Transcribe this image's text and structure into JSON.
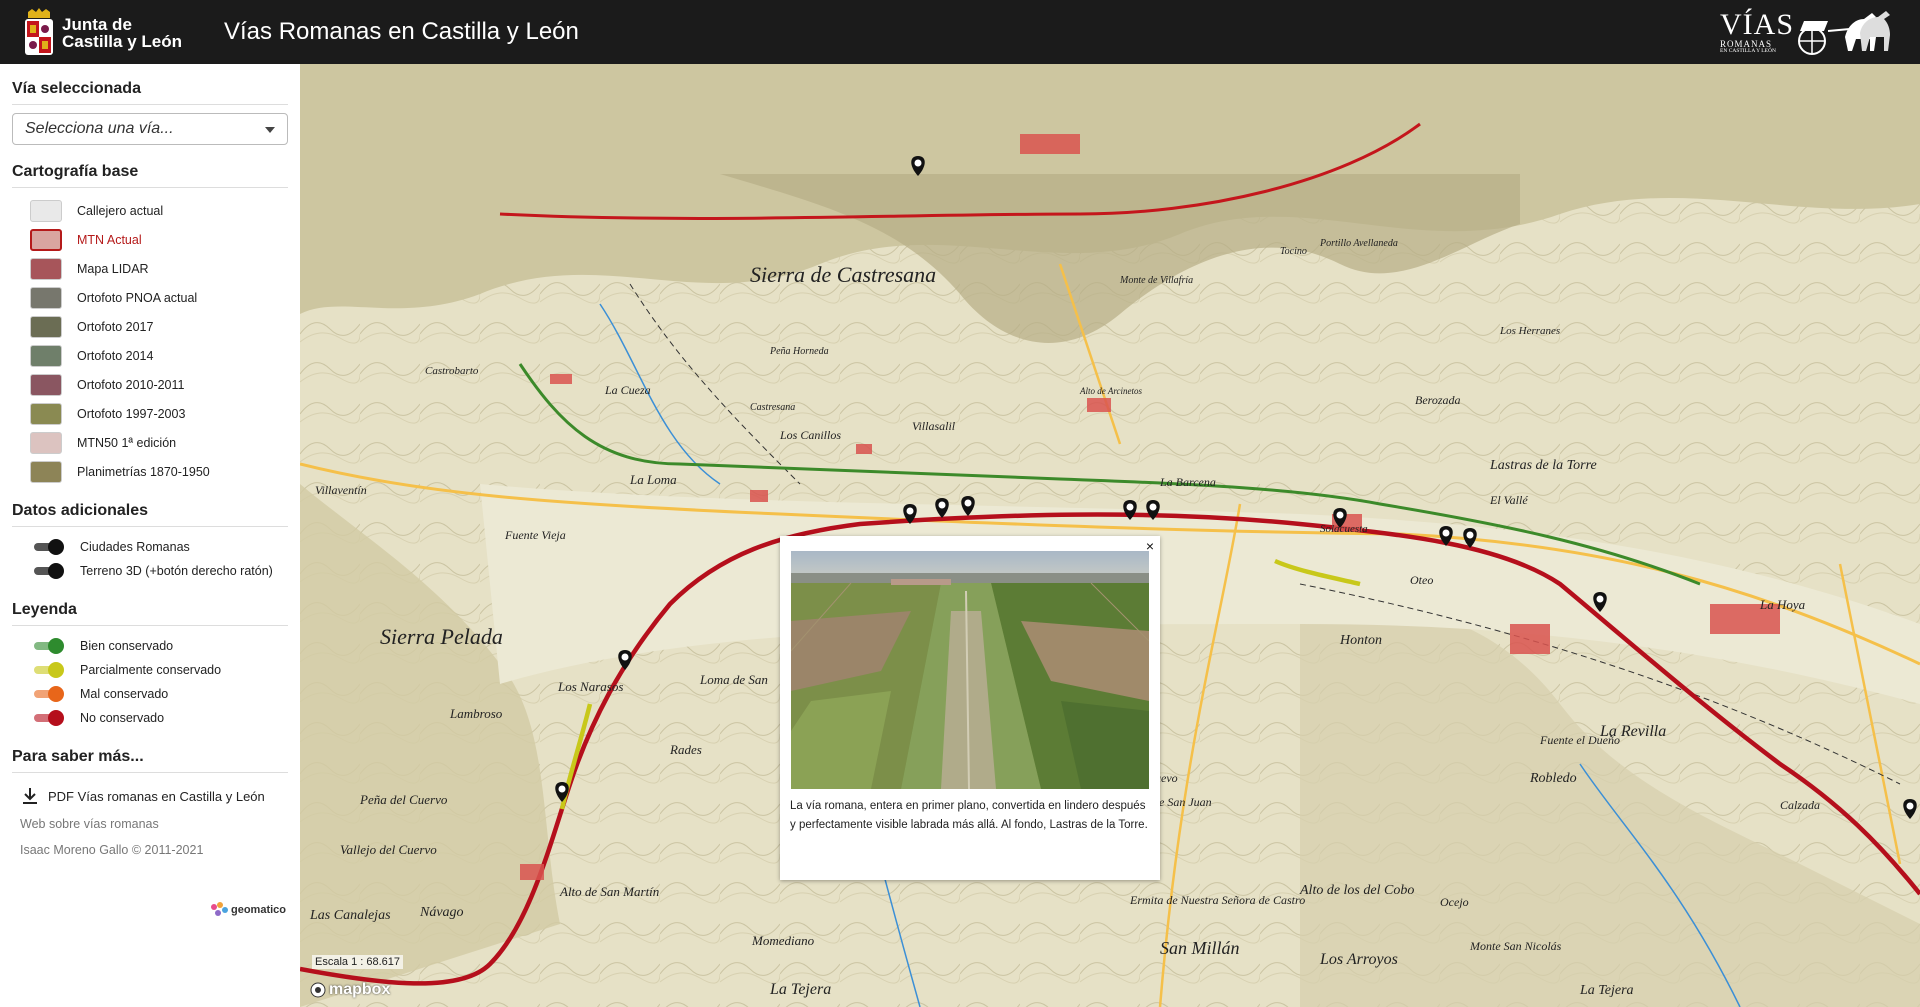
{
  "header": {
    "logo_line1": "Junta de",
    "logo_line2": "Castilla y León",
    "title": "Vías Romanas en Castilla y León",
    "brand_big": "VÍAS",
    "brand_small": "ROMANAS",
    "brand_tiny": "EN CASTILLA Y LEÓN"
  },
  "sidebar": {
    "via_title": "Vía seleccionada",
    "via_placeholder": "Selecciona una vía...",
    "carto_title": "Cartografía base",
    "layers": [
      {
        "label": "Callejero actual",
        "color": "#e9e9e9",
        "active": false
      },
      {
        "label": "MTN Actual",
        "color": "#d9a5a0",
        "active": true
      },
      {
        "label": "Mapa LIDAR",
        "color": "#a7555a",
        "active": false
      },
      {
        "label": "Ortofoto PNOA actual",
        "color": "#77776d",
        "active": false
      },
      {
        "label": "Ortofoto 2017",
        "color": "#6b6d54",
        "active": false
      },
      {
        "label": "Ortofoto 2014",
        "color": "#6f7f6a",
        "active": false
      },
      {
        "label": "Ortofoto 2010-2011",
        "color": "#8a5661",
        "active": false
      },
      {
        "label": "Ortofoto 1997-2003",
        "color": "#8a8a52",
        "active": false
      },
      {
        "label": "MTN50 1ª edición",
        "color": "#dcc3c0",
        "active": false
      },
      {
        "label": "Planimetrías 1870-1950",
        "color": "#8d8457",
        "active": false
      }
    ],
    "datos_title": "Datos adicionales",
    "datos": [
      {
        "label": "Ciudades Romanas"
      },
      {
        "label": "Terreno 3D (+botón derecho ratón)"
      }
    ],
    "leyenda_title": "Leyenda",
    "leyenda": [
      {
        "label": "Bien conservado",
        "color": "#2e8b2e"
      },
      {
        "label": "Parcialmente conservado",
        "color": "#c8c81a"
      },
      {
        "label": "Mal conservado",
        "color": "#e8661a"
      },
      {
        "label": "No conservado",
        "color": "#b50f1c"
      }
    ],
    "mas_title": "Para saber más...",
    "pdf_link": "PDF Vías romanas en Castilla y León",
    "web_link": "Web sobre vías romanas",
    "copyright": "Isaac Moreno Gallo © 2011-2021",
    "geomatico": "geomatico"
  },
  "map": {
    "scale": "Escala 1 : 68.617",
    "attribution": "mapbox",
    "labels": [
      "Sierra de Castresana",
      "Castrobarto",
      "Castresana",
      "Villaventín",
      "Fuente Vieja",
      "La Loma",
      "Villasalil",
      "Lastras de la Torre",
      "Oteo",
      "Sierra Pelada",
      "Návago",
      "Momediano",
      "La Tejera",
      "Los Arroyos",
      "Robledo",
      "La Revilla",
      "Loma de San",
      "Alto de San Martín",
      "Los Narasos",
      "Lambroso",
      "Rades",
      "La Cueza",
      "Peña Horneda",
      "Los Canillos",
      "La Barcena",
      "Solacuesta",
      "Berozada",
      "Los Herranes",
      "Monte de Villafría",
      "Calzada",
      "Honton",
      "Pozo Nuevo",
      "Alto de San Juan",
      "Alto de los del Cobo",
      "Monte San Nicolás",
      "San Millán",
      "Ermita de Nuestra Señora de Castro",
      "Peña del Cuervo",
      "Vallejo del Cuervo",
      "Las Canalejas",
      "El Vallé",
      "La Hoya",
      "Fuente el Dueño",
      "Tocino",
      "Portillo Avellaneda",
      "Alto de Arcinetos",
      "Ocejo",
      "La Tejera"
    ]
  },
  "popup": {
    "close": "×",
    "caption": "La vía romana, entera en primer plano, convertida en lindero después y perfectamente visible labrada más allá. Al fondo, Lastras de la Torre."
  }
}
